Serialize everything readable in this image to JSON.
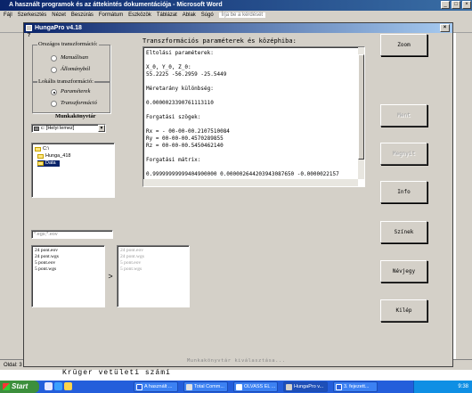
{
  "word": {
    "title": "A használt programok és az áttekintés dokumentációja - Microsoft Word",
    "menu": [
      "Fájl",
      "Szerkesztés",
      "Nézet",
      "Beszúrás",
      "Formátum",
      "Eszközök",
      "Táblázat",
      "Ablak",
      "Súgó"
    ],
    "help_box": "Írja be a kérdését",
    "status_text": "Oldal: 3",
    "bottom_text": "Krüger  vetületi  számí"
  },
  "dialog": {
    "title": "HungaPro v4.18",
    "close_glyph": "×",
    "help_glyph": "?",
    "transform_group": {
      "legend": "Országos transzformáció:",
      "options": [
        "Manuálisan",
        "Állományból"
      ]
    },
    "local_group": {
      "legend": "Lokális transzformáció:",
      "options": [
        "Paraméterek",
        "Transzformáció"
      ]
    },
    "workdir_label": "Munkakönyvtár",
    "drive": "c: [Helyi lemez]",
    "drive_arrow": "▼",
    "folders": [
      "C:\\",
      "Hunga_418",
      "Data"
    ],
    "filter": "*.egs;*.eov",
    "source_files": [
      "24 pont.eov",
      "24 pont.wgs",
      "5 pont.eov",
      "5 pont.wgs"
    ],
    "target_files": [
      "24 pont.eov",
      "24 pont.wgs",
      "5 pont.eov",
      "5 pont.wgs"
    ],
    "move_glyph": ">",
    "params": {
      "title": "Transzformációs paraméterek és középhiba:",
      "lines": [
        "Eltolási paraméterek:",
        "",
        "X_0, Y_0, Z_0:",
        "55.2225    -56.2959    -25.5449",
        "",
        "Méretarány különbség:",
        "",
        "0.0000023390761113110",
        "",
        "Forgatási szögek:",
        "",
        "Rx =   - 00-00-00.2107510084",
        "Ry =     00-00-00.4570289855",
        "Rz =     00-00-00.5450462140",
        "",
        "Forgatási mátrix:",
        "",
        "0.99999999999404900000     0.000002644203943087650    -0.0000022157"
      ]
    },
    "status_line": "Munkakönyvtár kiválasztása...",
    "buttons": {
      "zoom": "Zoom",
      "save": "Ment",
      "open": "Megnyit",
      "info": "Info",
      "colors": "Színek",
      "about": "Névjegy",
      "exit": "Kilép"
    }
  },
  "taskbar": {
    "start": "Start",
    "items": [
      "A használt ...",
      "Total Comm...",
      "OLVASS EL ...",
      "HungaPro v...",
      "3. fejezett..."
    ],
    "clock": "9:38"
  }
}
